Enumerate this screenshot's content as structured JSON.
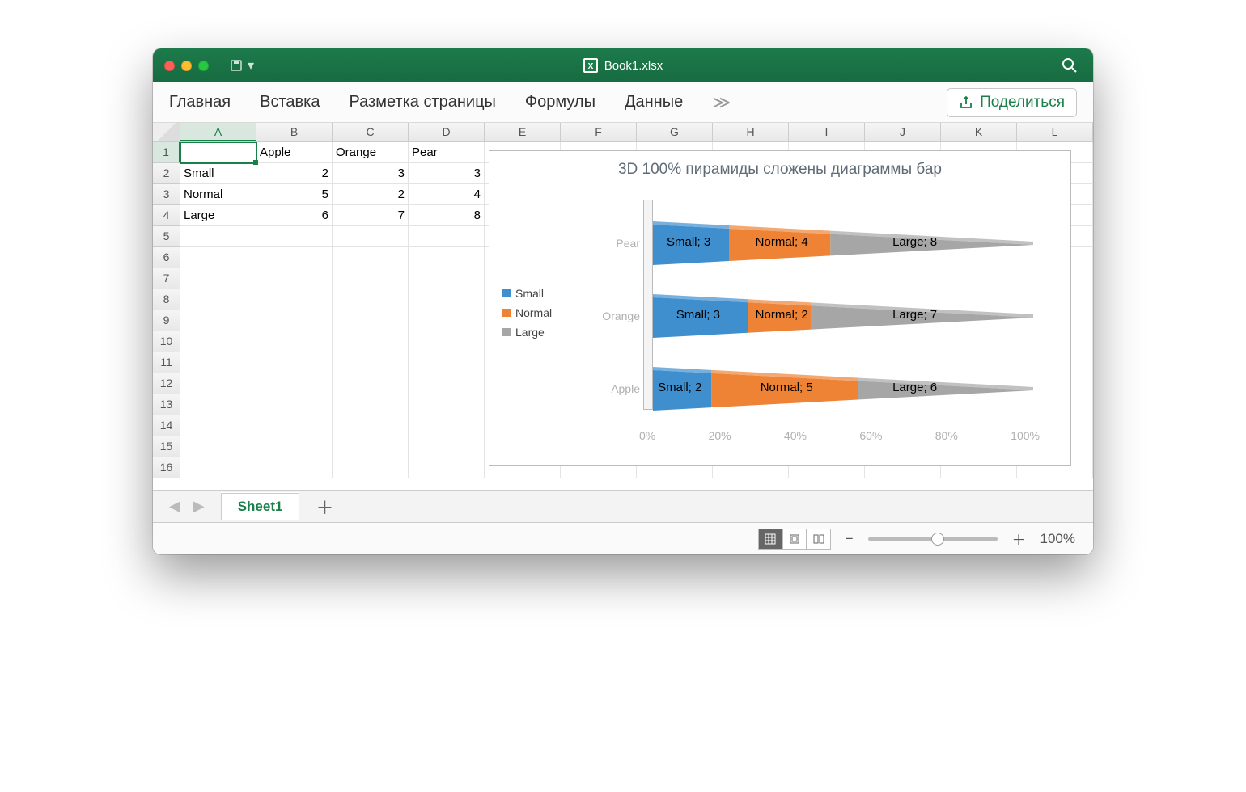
{
  "window": {
    "title": "Book1.xlsx"
  },
  "tabs": {
    "items": [
      "Главная",
      "Вставка",
      "Разметка страницы",
      "Формулы",
      "Данные"
    ],
    "more": "≫",
    "share": "Поделиться"
  },
  "columns": [
    "A",
    "B",
    "C",
    "D",
    "E",
    "F",
    "G",
    "H",
    "I",
    "J",
    "K",
    "L"
  ],
  "rows_visible": 16,
  "sheet": {
    "data": [
      [
        "",
        "Apple",
        "Orange",
        "Pear"
      ],
      [
        "Small",
        "2",
        "3",
        "3"
      ],
      [
        "Normal",
        "5",
        "2",
        "4"
      ],
      [
        "Large",
        "6",
        "7",
        "8"
      ]
    ],
    "active_cell": "A1"
  },
  "chart_data": {
    "type": "bar",
    "title": "3D 100% пирамиды сложены диаграммы бар",
    "categories": [
      "Apple",
      "Orange",
      "Pear"
    ],
    "series": [
      {
        "name": "Small",
        "values": [
          2,
          3,
          3
        ],
        "color": "#3f8fcf"
      },
      {
        "name": "Normal",
        "values": [
          5,
          2,
          4
        ],
        "color": "#ee8336"
      },
      {
        "name": "Large",
        "values": [
          6,
          7,
          8
        ],
        "color": "#a6a6a6"
      }
    ],
    "xlabel": "",
    "ylabel": "",
    "xlim_percent": [
      0,
      100
    ],
    "xticks_percent": [
      "0%",
      "20%",
      "40%",
      "60%",
      "80%",
      "100%"
    ],
    "data_labels": {
      "Pear": [
        "Small; 3",
        "Normal; 4",
        "Large; 8"
      ],
      "Orange": [
        "Small; 3",
        "Normal; 2",
        "Large; 7"
      ],
      "Apple": [
        "Small; 2",
        "Normal; 5",
        "Large; 6"
      ]
    },
    "stacked_100": true,
    "display_order_top_to_bottom": [
      "Pear",
      "Orange",
      "Apple"
    ]
  },
  "legend": {
    "items": [
      {
        "name": "Small",
        "color": "#3f8fcf"
      },
      {
        "name": "Normal",
        "color": "#ee8336"
      },
      {
        "name": "Large",
        "color": "#a6a6a6"
      }
    ]
  },
  "sheet_tabs": {
    "active": "Sheet1"
  },
  "status": {
    "zoom": "100%"
  }
}
